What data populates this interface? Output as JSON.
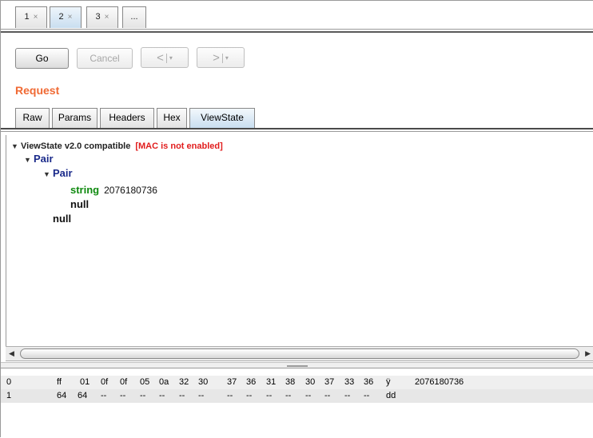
{
  "top_tabs": [
    {
      "label": "1",
      "close": "×"
    },
    {
      "label": "2",
      "close": "×"
    },
    {
      "label": "3",
      "close": "×"
    },
    {
      "label": "..."
    }
  ],
  "toolbar": {
    "go": "Go",
    "cancel": "Cancel",
    "back": "<",
    "forward": ">",
    "dropdown": "▾"
  },
  "section_title": "Request",
  "sub_tabs": [
    "Raw",
    "Params",
    "Headers",
    "Hex",
    "ViewState"
  ],
  "tree": {
    "header": "ViewState v2.0 compatible",
    "mac_status": "[MAC is not enabled]",
    "pair_outer": "Pair",
    "pair_inner": "Pair",
    "string_kw": "string",
    "string_value": "2076180736",
    "null_inner": "null",
    "null_outer": "null"
  },
  "hex_rows": [
    {
      "index": "0",
      "bytes": [
        "ff",
        "01",
        "0f",
        "0f",
        "05",
        "0a",
        "32",
        "30",
        "37",
        "36",
        "31",
        "38",
        "30",
        "37",
        "33",
        "36"
      ],
      "ascii1": "ÿ",
      "ascii2": "2076180736"
    },
    {
      "index": "1",
      "bytes": [
        "64",
        "64",
        "--",
        "--",
        "--",
        "--",
        "--",
        "--",
        "--",
        "--",
        "--",
        "--",
        "--",
        "--",
        "--",
        "--"
      ],
      "ascii1": "dd",
      "ascii2": ""
    }
  ]
}
